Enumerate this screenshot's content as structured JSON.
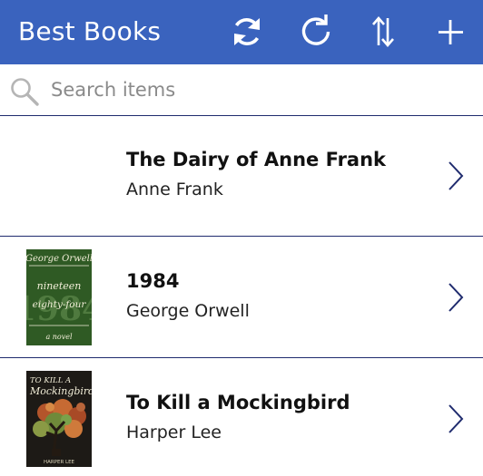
{
  "header": {
    "title": "Best Books",
    "bg_color": "#3a63be",
    "buttons": [
      {
        "name": "sync-icon"
      },
      {
        "name": "refresh-icon"
      },
      {
        "name": "sort-icon"
      },
      {
        "name": "add-icon"
      }
    ]
  },
  "search": {
    "placeholder": "Search items",
    "value": ""
  },
  "items": [
    {
      "title": "The Dairy of Anne Frank",
      "author": "Anne Frank",
      "cover": "none"
    },
    {
      "title": "1984",
      "author": "George Orwell",
      "cover": "1984-cover"
    },
    {
      "title": "To Kill a Mockingbird",
      "author": "Harper Lee",
      "cover": "mockingbird-cover"
    }
  ],
  "covers": {
    "orwell": {
      "author": "George Orwell",
      "line1": "nineteen",
      "line2": "eighty-four",
      "bignum": "1984",
      "tag": "a novel"
    },
    "mockingbird": {
      "line1": "TO KILL A",
      "line2": "Mockingbird",
      "author": "HARPER LEE"
    }
  },
  "colors": {
    "divider": "#1f2b6e",
    "chevron": "#1f2b6e"
  }
}
